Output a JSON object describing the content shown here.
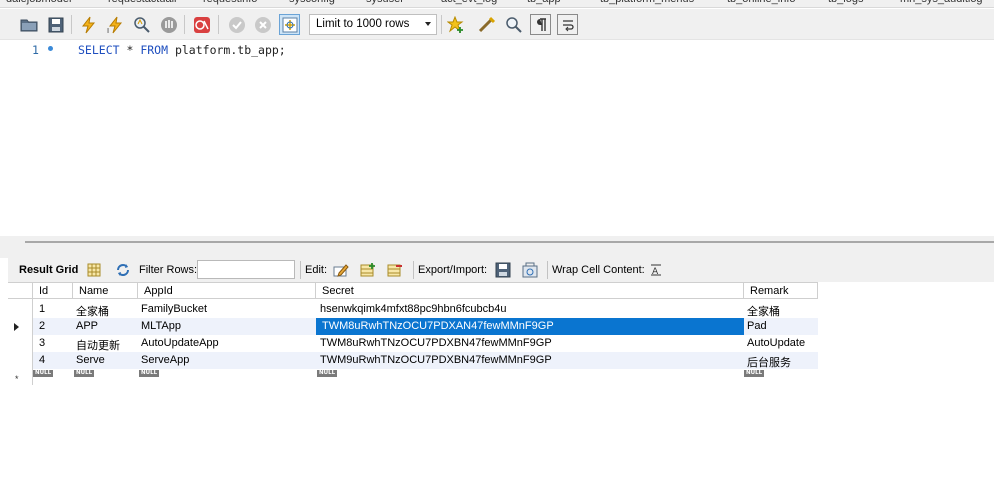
{
  "tabs": [
    "dalejobmodel",
    "requestactuall",
    "requestinfo",
    "sysconfig",
    "sysuser",
    "act_evt_log",
    "tb_app",
    "tb_platform_menus",
    "tb_online_info",
    "tb_logs",
    "mh_sys_auditlog"
  ],
  "toolbar": {
    "limit_label": "Limit to 1000 rows"
  },
  "editor": {
    "line_number": "1",
    "code": {
      "kw_select": "SELECT",
      "star": " * ",
      "kw_from": "FROM",
      "rest": " platform.tb_app;"
    }
  },
  "result": {
    "grid_label": "Result Grid",
    "filter_label": "Filter Rows:",
    "edit_label": "Edit:",
    "export_label": "Export/Import:",
    "wrap_label": "Wrap Cell Content:",
    "columns": [
      "Id",
      "Name",
      "AppId",
      "Secret",
      "Remark"
    ],
    "rows": [
      {
        "id": "1",
        "name": "全家桶",
        "appid": "FamilyBucket",
        "secret": "hsenwkqimk4mfxt88pc9hbn6fcubcb4u",
        "remark": "全家桶"
      },
      {
        "id": "2",
        "name": "APP",
        "appid": "MLTApp",
        "secret": "TWM8uRwhTNzOCU7PDXAN47fewMMnF9GP",
        "remark": "Pad"
      },
      {
        "id": "3",
        "name": "自动更新",
        "appid": "AutoUpdateApp",
        "secret": "TWM8uRwhTNzOCU7PDXBN47fewMMnF9GP",
        "remark": "AutoUpdate"
      },
      {
        "id": "4",
        "name": "Serve",
        "appid": "ServeApp",
        "secret": "TWM9uRwhTNzOCU7PDXBN47fewMMnF9GP",
        "remark": "后台服务"
      }
    ],
    "null_text": "NULL",
    "new_row_marker": "*"
  }
}
